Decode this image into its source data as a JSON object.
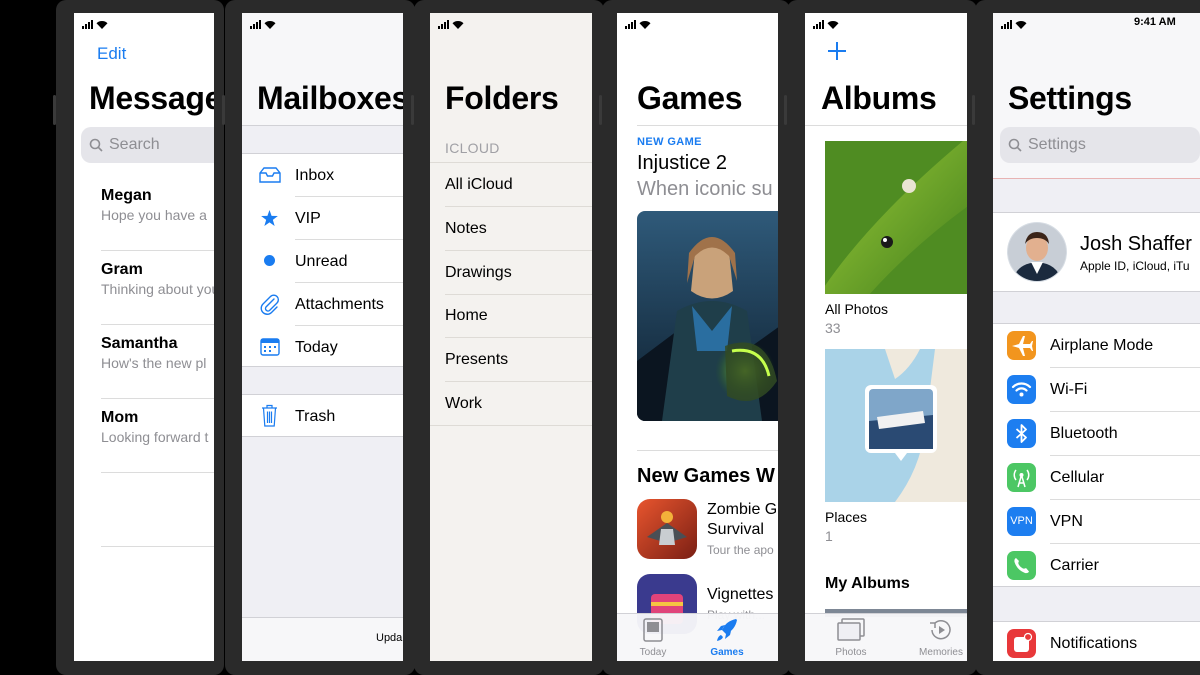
{
  "status": {
    "time": "9:41 AM"
  },
  "messages": {
    "edit_label": "Edit",
    "title": "Messages",
    "search_placeholder": "Search",
    "items": [
      {
        "name": "Megan",
        "preview": "Hope you have a"
      },
      {
        "name": "Gram",
        "preview": "Thinking about you"
      },
      {
        "name": "Samantha",
        "preview": "How's the new pl"
      },
      {
        "name": "Mom",
        "preview": "Looking forward t"
      }
    ]
  },
  "mail": {
    "title": "Mailboxes",
    "items": [
      {
        "label": "Inbox",
        "icon": "inbox-tray-icon"
      },
      {
        "label": "VIP",
        "icon": "star-icon"
      },
      {
        "label": "Unread",
        "icon": "dot-icon"
      },
      {
        "label": "Attachments",
        "icon": "paperclip-icon"
      },
      {
        "label": "Today",
        "icon": "calendar-icon"
      }
    ],
    "trash": {
      "label": "Trash",
      "icon": "trash-icon"
    },
    "footer": "Upda"
  },
  "notes": {
    "title": "Folders",
    "section": "ICLOUD",
    "folders": [
      "All iCloud",
      "Notes",
      "Drawings",
      "Home",
      "Presents",
      "Work"
    ]
  },
  "appstore": {
    "title": "Games",
    "eyebrow": "NEW GAME",
    "feature_title": "Injustice 2",
    "feature_subtitle": "When iconic su",
    "section_title": "New Games W",
    "apps": [
      {
        "name_line1": "Zombie G",
        "name_line2": "Survival",
        "subtitle": "Tour the apo"
      },
      {
        "name_line1": "Vignettes",
        "name_line2": "",
        "subtitle": "Play with..."
      }
    ],
    "tabs": [
      {
        "label": "Today",
        "icon": "today-icon",
        "active": false
      },
      {
        "label": "Games",
        "icon": "rocket-icon",
        "active": true
      }
    ]
  },
  "photos": {
    "add_label": "+",
    "title": "Albums",
    "albums": [
      {
        "name": "All Photos",
        "count": "33"
      },
      {
        "name": "Places",
        "count": "1"
      }
    ],
    "my_albums_label": "My Albums",
    "tabs": [
      {
        "label": "Photos",
        "icon": "photos-icon"
      },
      {
        "label": "Memories",
        "icon": "memories-icon"
      }
    ]
  },
  "settings": {
    "title": "Settings",
    "search_placeholder": "Settings",
    "profile": {
      "name": "Josh Shaffer",
      "subtitle": "Apple ID, iCloud, iTu"
    },
    "items": [
      {
        "label": "Airplane Mode",
        "icon": "airplane-icon",
        "color": "#f2951e"
      },
      {
        "label": "Wi-Fi",
        "icon": "wifi-icon",
        "color": "#1d7ef0"
      },
      {
        "label": "Bluetooth",
        "icon": "bluetooth-icon",
        "color": "#1d7ef0"
      },
      {
        "label": "Cellular",
        "icon": "cellular-icon",
        "color": "#4cc764"
      },
      {
        "label": "VPN",
        "icon": "vpn-icon",
        "color": "#1d7ef0"
      },
      {
        "label": "Carrier",
        "icon": "phone-icon",
        "color": "#4cc764"
      }
    ],
    "notifications": {
      "label": "Notifications",
      "icon": "notifications-icon",
      "color": "#e8383a"
    }
  },
  "colors": {
    "accent": "#1a7cf0",
    "secondary": "#8e8e93"
  }
}
